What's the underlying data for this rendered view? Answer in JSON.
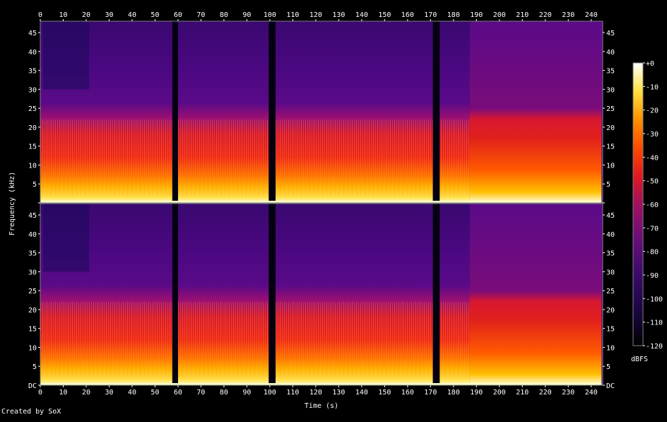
{
  "credit": "Created by SoX",
  "chart_data": {
    "type": "heatmap",
    "xlabel": "Time (s)",
    "ylabel": "Frequency (kHz)",
    "xlim": [
      0,
      245
    ],
    "ylim": [
      0,
      48
    ],
    "x_ticks": [
      0,
      10,
      20,
      30,
      40,
      50,
      60,
      70,
      80,
      90,
      100,
      110,
      120,
      130,
      140,
      150,
      160,
      170,
      180,
      190,
      200,
      210,
      220,
      230,
      240
    ],
    "y_ticks": [
      "DC",
      "5",
      "10",
      "15",
      "20",
      "25",
      "30",
      "35",
      "40",
      "45"
    ],
    "y_tick_values": [
      0,
      5,
      10,
      15,
      20,
      25,
      30,
      35,
      40,
      45
    ],
    "channels": 2,
    "colorbar": {
      "label": "dBFS",
      "ticks": [
        "+0",
        "-10",
        "-20",
        "-30",
        "-40",
        "-50",
        "-60",
        "-70",
        "-80",
        "-90",
        "-100",
        "-110",
        "-120"
      ],
      "tick_values": [
        0,
        -10,
        -20,
        -30,
        -40,
        -50,
        -60,
        -70,
        -80,
        -90,
        -100,
        -110,
        -120
      ],
      "range": [
        -120,
        0
      ]
    },
    "silence_gaps_s": [
      [
        57.5,
        60
      ],
      [
        99.5,
        102.5
      ],
      [
        171,
        174
      ]
    ],
    "track_end_s": 244.5
  }
}
